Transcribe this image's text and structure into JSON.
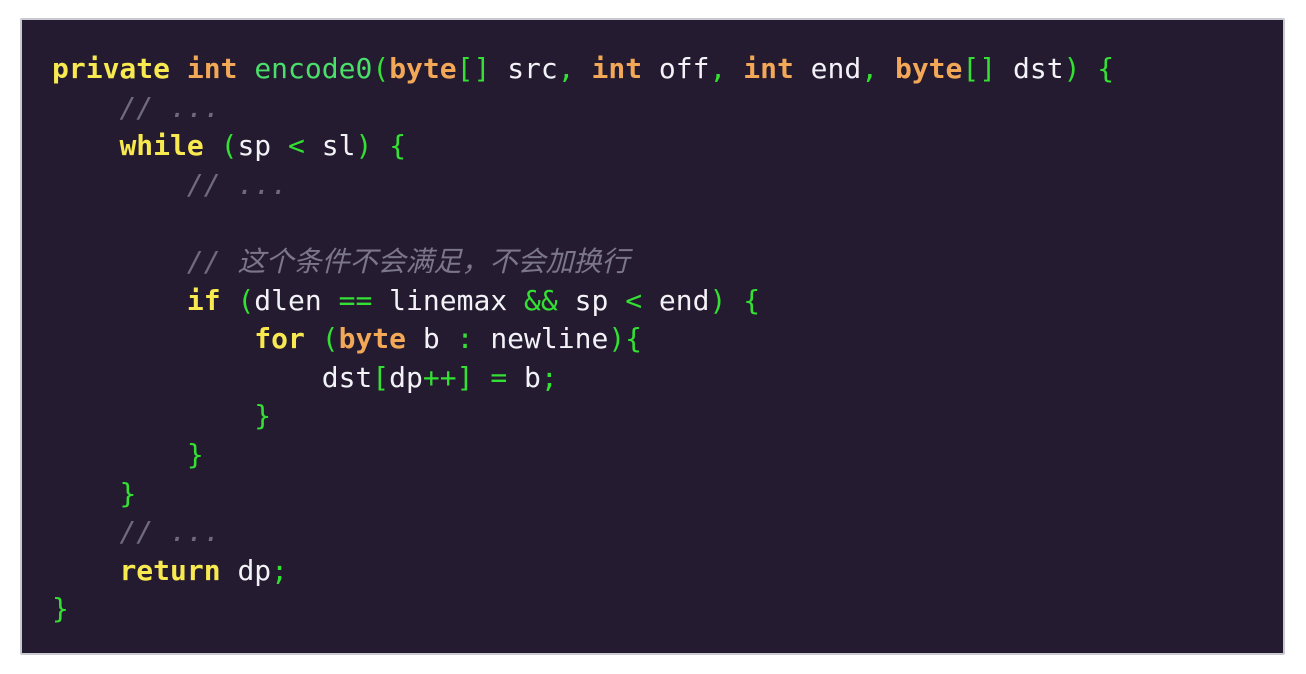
{
  "card": {
    "name": "code-snippet-card",
    "background_color": "#241b30",
    "border_color": "#c9c9d2",
    "page_background": "#ffffff"
  },
  "theme": {
    "keyword_color": "#f7e94f",
    "type_color": "#f3a857",
    "function_color": "#4ade6a",
    "punctuation_color": "#33e033",
    "identifier_color": "#f2f2f7",
    "comment_color": "#6f6a7d"
  },
  "code": {
    "language": "java",
    "plain_text": "private int encode0(byte[] src, int off, int end, byte[] dst) {\n    // ...\n    while (sp < sl) {\n        // ...\n\n        // 这个条件不会满足，不会加换行\n        if (dlen == linemax && sp < end) {\n            for (byte b : newline){\n                dst[dp++] = b;\n            }\n        }\n    }\n    // ...\n    return dp;\n}",
    "lines": [
      {
        "n": 1,
        "text": "private int encode0(byte[] src, int off, int end, byte[] dst) {",
        "tokens": [
          {
            "t": "private",
            "c": "kw"
          },
          {
            "t": " ",
            "c": "id"
          },
          {
            "t": "int",
            "c": "typ"
          },
          {
            "t": " ",
            "c": "id"
          },
          {
            "t": "encode0",
            "c": "fn"
          },
          {
            "t": "(",
            "c": "pun"
          },
          {
            "t": "byte",
            "c": "typ"
          },
          {
            "t": "[]",
            "c": "pun"
          },
          {
            "t": " src",
            "c": "id"
          },
          {
            "t": ",",
            "c": "pun"
          },
          {
            "t": " ",
            "c": "id"
          },
          {
            "t": "int",
            "c": "typ"
          },
          {
            "t": " off",
            "c": "id"
          },
          {
            "t": ",",
            "c": "pun"
          },
          {
            "t": " ",
            "c": "id"
          },
          {
            "t": "int",
            "c": "typ"
          },
          {
            "t": " end",
            "c": "id"
          },
          {
            "t": ",",
            "c": "pun"
          },
          {
            "t": " ",
            "c": "id"
          },
          {
            "t": "byte",
            "c": "typ"
          },
          {
            "t": "[]",
            "c": "pun"
          },
          {
            "t": " dst",
            "c": "id"
          },
          {
            "t": ") ",
            "c": "pun"
          },
          {
            "t": "{",
            "c": "pun"
          }
        ]
      },
      {
        "n": 2,
        "text": "    // ...",
        "tokens": [
          {
            "t": "    ",
            "c": "id"
          },
          {
            "t": "// ...",
            "c": "cmt"
          }
        ]
      },
      {
        "n": 3,
        "text": "    while (sp < sl) {",
        "tokens": [
          {
            "t": "    ",
            "c": "id"
          },
          {
            "t": "while",
            "c": "kw"
          },
          {
            "t": " ",
            "c": "id"
          },
          {
            "t": "(",
            "c": "pun"
          },
          {
            "t": "sp ",
            "c": "id"
          },
          {
            "t": "<",
            "c": "pun"
          },
          {
            "t": " sl",
            "c": "id"
          },
          {
            "t": ") ",
            "c": "pun"
          },
          {
            "t": "{",
            "c": "pun"
          }
        ]
      },
      {
        "n": 4,
        "text": "        // ...",
        "tokens": [
          {
            "t": "        ",
            "c": "id"
          },
          {
            "t": "// ...",
            "c": "cmt"
          }
        ]
      },
      {
        "n": 5,
        "text": "",
        "tokens": []
      },
      {
        "n": 6,
        "text": "        // 这个条件不会满足，不会加换行",
        "tokens": [
          {
            "t": "        ",
            "c": "id"
          },
          {
            "t": "// ",
            "c": "cmt"
          },
          {
            "t": "这个条件不会满足，不会加换行",
            "c": "cmt-cjk"
          }
        ]
      },
      {
        "n": 7,
        "text": "        if (dlen == linemax && sp < end) {",
        "tokens": [
          {
            "t": "        ",
            "c": "id"
          },
          {
            "t": "if",
            "c": "kw"
          },
          {
            "t": " ",
            "c": "id"
          },
          {
            "t": "(",
            "c": "pun"
          },
          {
            "t": "dlen ",
            "c": "id"
          },
          {
            "t": "==",
            "c": "pun"
          },
          {
            "t": " linemax ",
            "c": "id"
          },
          {
            "t": "&&",
            "c": "pun"
          },
          {
            "t": " sp ",
            "c": "id"
          },
          {
            "t": "<",
            "c": "pun"
          },
          {
            "t": " end",
            "c": "id"
          },
          {
            "t": ") ",
            "c": "pun"
          },
          {
            "t": "{",
            "c": "pun"
          }
        ]
      },
      {
        "n": 8,
        "text": "            for (byte b : newline){",
        "tokens": [
          {
            "t": "            ",
            "c": "id"
          },
          {
            "t": "for",
            "c": "kw"
          },
          {
            "t": " ",
            "c": "id"
          },
          {
            "t": "(",
            "c": "pun"
          },
          {
            "t": "byte",
            "c": "typ"
          },
          {
            "t": " b ",
            "c": "id"
          },
          {
            "t": ":",
            "c": "pun"
          },
          {
            "t": " newline",
            "c": "id"
          },
          {
            "t": "){",
            "c": "pun"
          }
        ]
      },
      {
        "n": 9,
        "text": "                dst[dp++] = b;",
        "tokens": [
          {
            "t": "                ",
            "c": "id"
          },
          {
            "t": "dst",
            "c": "id"
          },
          {
            "t": "[",
            "c": "pun"
          },
          {
            "t": "dp",
            "c": "id"
          },
          {
            "t": "++]",
            "c": "pun"
          },
          {
            "t": " ",
            "c": "id"
          },
          {
            "t": "=",
            "c": "pun"
          },
          {
            "t": " b",
            "c": "id"
          },
          {
            "t": ";",
            "c": "pun"
          }
        ]
      },
      {
        "n": 10,
        "text": "            }",
        "tokens": [
          {
            "t": "            ",
            "c": "id"
          },
          {
            "t": "}",
            "c": "pun"
          }
        ]
      },
      {
        "n": 11,
        "text": "        }",
        "tokens": [
          {
            "t": "        ",
            "c": "id"
          },
          {
            "t": "}",
            "c": "pun"
          }
        ]
      },
      {
        "n": 12,
        "text": "    }",
        "tokens": [
          {
            "t": "    ",
            "c": "id"
          },
          {
            "t": "}",
            "c": "pun"
          }
        ]
      },
      {
        "n": 13,
        "text": "    // ...",
        "tokens": [
          {
            "t": "    ",
            "c": "id"
          },
          {
            "t": "// ...",
            "c": "cmt"
          }
        ]
      },
      {
        "n": 14,
        "text": "    return dp;",
        "tokens": [
          {
            "t": "    ",
            "c": "id"
          },
          {
            "t": "return",
            "c": "kw"
          },
          {
            "t": " dp",
            "c": "id"
          },
          {
            "t": ";",
            "c": "pun"
          }
        ]
      },
      {
        "n": 15,
        "text": "}",
        "tokens": [
          {
            "t": "}",
            "c": "pun"
          }
        ]
      }
    ]
  }
}
